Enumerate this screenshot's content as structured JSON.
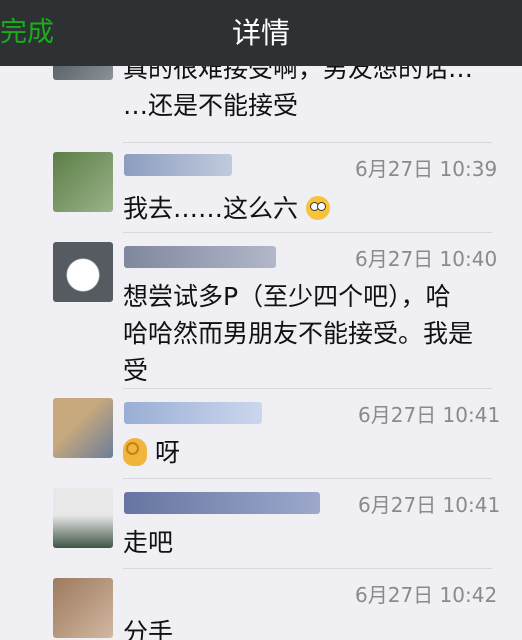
{
  "navbar": {
    "done_label": "完成",
    "title": "详情"
  },
  "messages": [
    {
      "time": "",
      "lines": [
        "真的很难接受啊，男友想的话…",
        "…还是不能接受"
      ],
      "avatar_colors": [
        "#51585e",
        "#8c929a"
      ],
      "nick_colors": []
    },
    {
      "time": "6月27日 10:39",
      "text": "我去……这么六",
      "emoji": "astonished-face-icon",
      "avatar_colors": [
        "#5b7e47",
        "#9bb38a"
      ],
      "nick_colors": [
        "#7a8fb5",
        "#b9c4da"
      ]
    },
    {
      "time": "6月27日 10:40",
      "lines": [
        "想尝试多P（至少四个吧），哈",
        "哈哈然而男朋友不能接受。我是",
        "受"
      ],
      "avatar_colors": [
        "#555b60",
        "#ffffff"
      ],
      "nick_colors": [
        "#6c7590",
        "#a7aec2"
      ]
    },
    {
      "time": "6月27日 10:41",
      "text": "呀",
      "emoji": "ok-hand-icon",
      "avatar_colors": [
        "#c7a97d",
        "#6b7e9a"
      ],
      "nick_colors": [
        "#8aa3cf",
        "#c5d2ec"
      ]
    },
    {
      "time": "6月27日 10:41",
      "text": "走吧",
      "avatar_colors": [
        "#e8e8e8",
        "#3f5545"
      ],
      "nick_colors": [
        "#4e5f93",
        "#8e9bc4"
      ]
    },
    {
      "time": "6月27日 10:42",
      "text": "分手",
      "avatar_colors": [
        "#9c7a5e",
        "#d2b7a1"
      ],
      "nick_colors": []
    }
  ]
}
